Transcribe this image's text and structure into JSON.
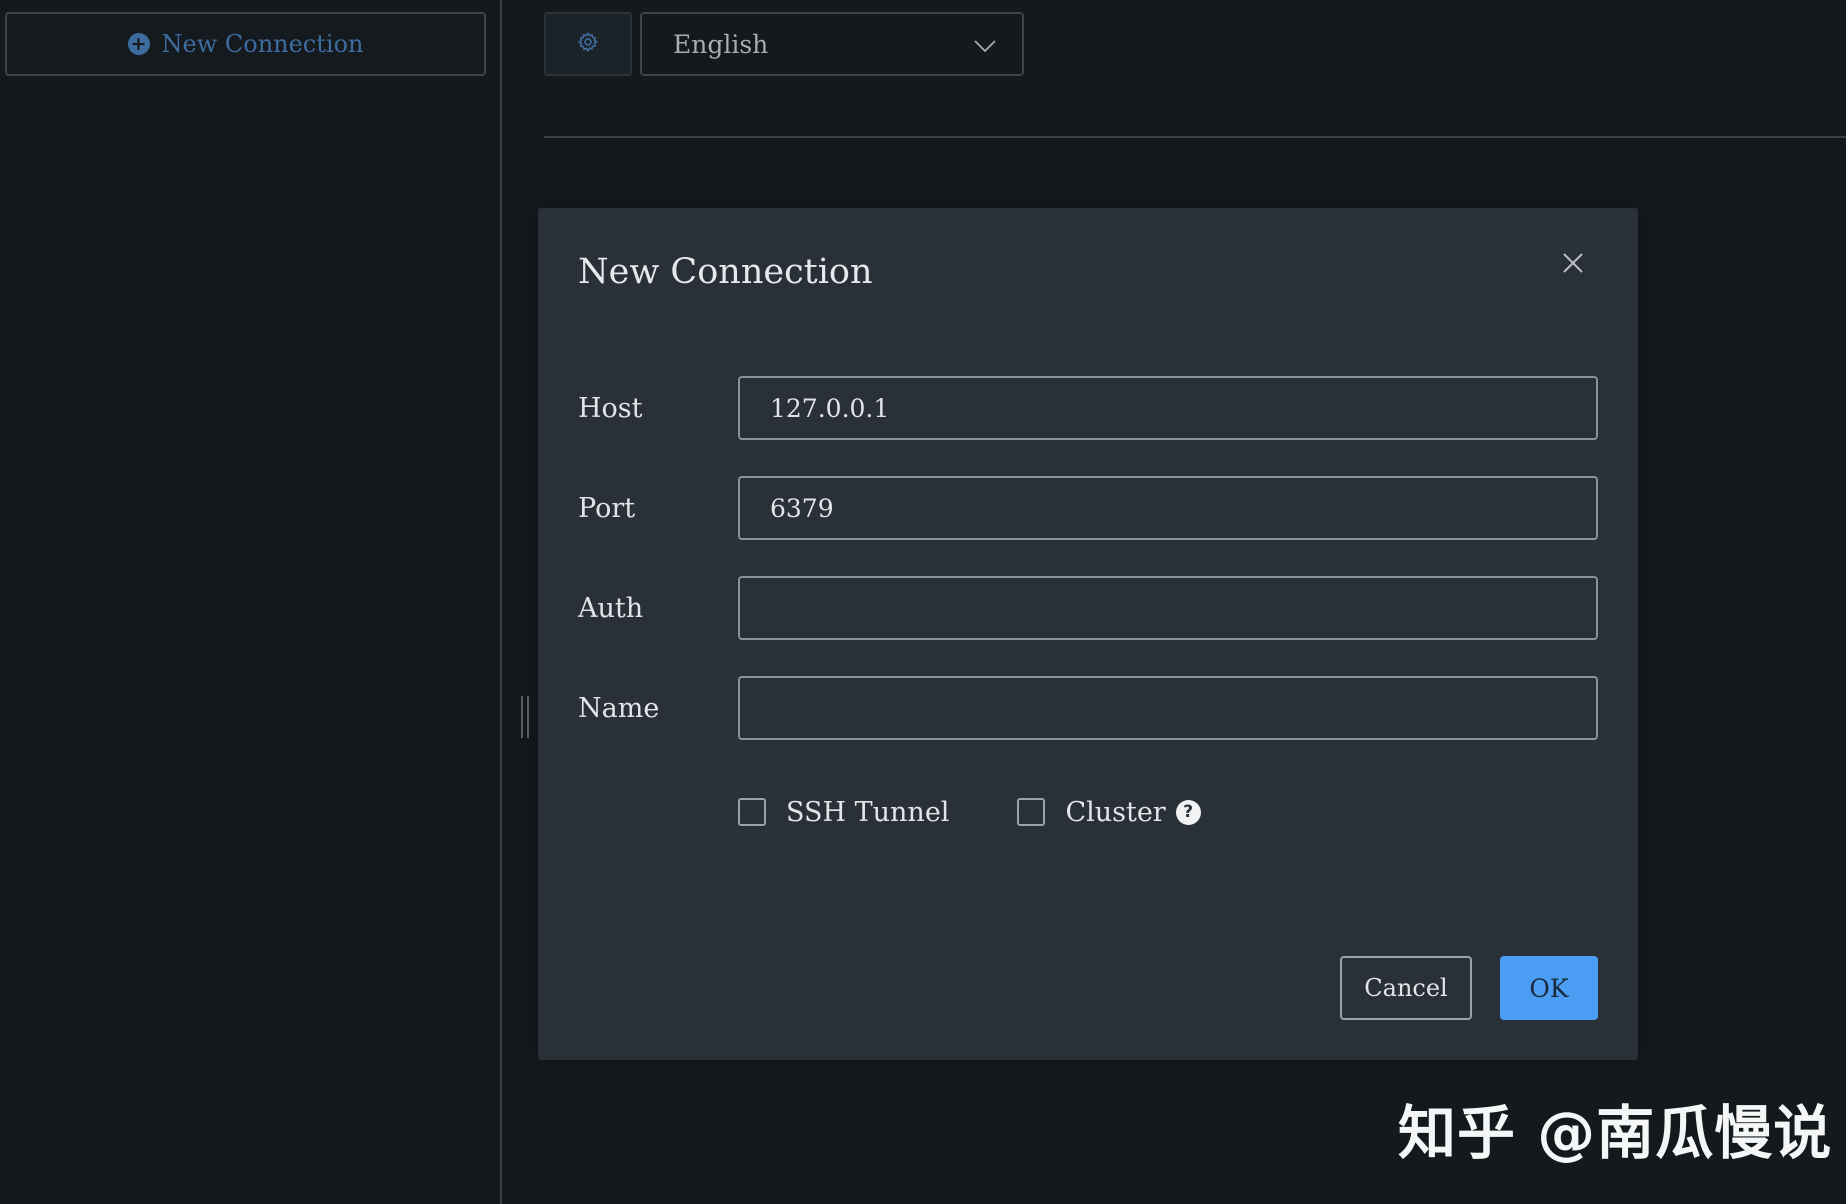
{
  "sidebar": {
    "new_connection_label": "New Connection",
    "new_connection_icon": "plus-circle-icon"
  },
  "toolbar": {
    "settings_icon": "gear-icon",
    "language": {
      "selected": "English",
      "icon": "chevron-down-icon"
    }
  },
  "dialog": {
    "title": "New Connection",
    "close_icon": "close-icon",
    "fields": {
      "host": {
        "label": "Host",
        "value": "127.0.0.1"
      },
      "port": {
        "label": "Port",
        "value": "6379"
      },
      "auth": {
        "label": "Auth",
        "value": ""
      },
      "name": {
        "label": "Name",
        "value": ""
      }
    },
    "options": {
      "ssh_tunnel": {
        "label": "SSH Tunnel",
        "checked": false
      },
      "cluster": {
        "label": "Cluster",
        "checked": false,
        "help_icon": "question-circle-icon"
      }
    },
    "buttons": {
      "cancel": "Cancel",
      "ok": "OK"
    }
  },
  "watermark": "知乎 @南瓜慢说",
  "colors": {
    "background": "#14191c",
    "dialog": "#293038",
    "primary": "#4a9df3",
    "link": "#3d6c9f"
  }
}
